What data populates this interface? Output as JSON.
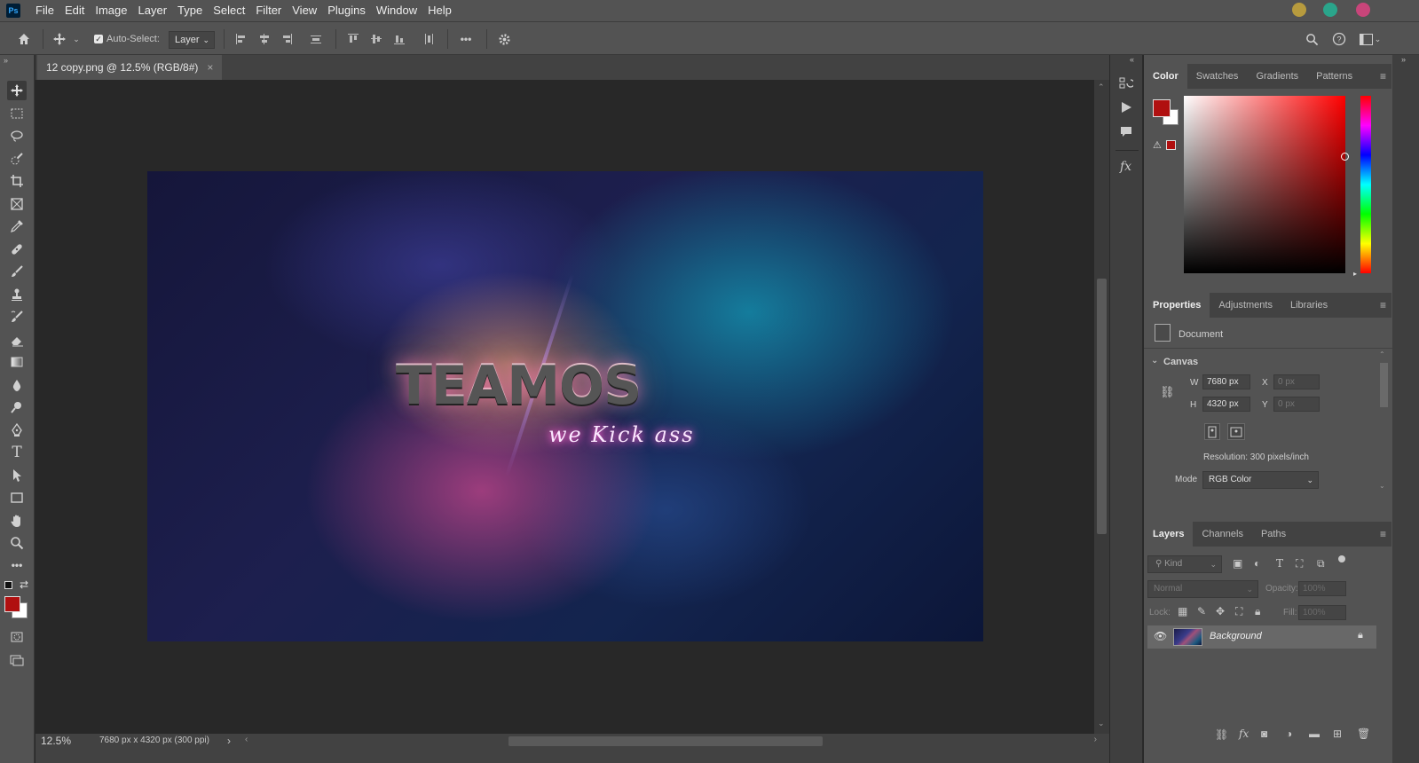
{
  "app": {
    "logo": "Ps"
  },
  "menu": [
    "File",
    "Edit",
    "Image",
    "Layer",
    "Type",
    "Select",
    "Filter",
    "View",
    "Plugins",
    "Window",
    "Help"
  ],
  "window_controls": {
    "colors": [
      "#b79b3e",
      "#2aa58b",
      "#c8457a"
    ]
  },
  "options_bar": {
    "auto_select_label": "Auto-Select:",
    "auto_select_checked": true,
    "target_value": "Layer",
    "more_label": "•••"
  },
  "document": {
    "tab_title": "12 copy.png @ 12.5% (RGB/8#)",
    "close_glyph": "×",
    "image_text": "TEAMOS",
    "image_subtext": "we Kick ass"
  },
  "status_bar": {
    "zoom": "12.5%",
    "doc_info": "7680 px x 4320 px (300 ppi)",
    "arrow": "›"
  },
  "color_panel": {
    "tabs": [
      "Color",
      "Swatches",
      "Gradients",
      "Patterns"
    ],
    "active_tab": "Color",
    "foreground": "#b01010",
    "background": "#ffffff"
  },
  "properties_panel": {
    "tabs": [
      "Properties",
      "Adjustments",
      "Libraries"
    ],
    "active_tab": "Properties",
    "section_label": "Document",
    "canvas_heading": "Canvas",
    "width_label": "W",
    "width_value": "7680 px",
    "height_label": "H",
    "height_value": "4320 px",
    "x_label": "X",
    "x_placeholder": "0 px",
    "y_label": "Y",
    "y_placeholder": "0 px",
    "resolution": "Resolution: 300 pixels/inch",
    "mode_label": "Mode",
    "mode_value": "RGB Color"
  },
  "layers_panel": {
    "tabs": [
      "Layers",
      "Channels",
      "Paths"
    ],
    "active_tab": "Layers",
    "filter_placeholder": "Kind",
    "blend_mode": "Normal",
    "opacity_label": "Opacity:",
    "opacity_value": "100%",
    "lock_label": "Lock:",
    "fill_label": "Fill:",
    "fill_value": "100%",
    "layers": [
      {
        "name": "Background",
        "visible": true,
        "locked": true
      }
    ]
  }
}
